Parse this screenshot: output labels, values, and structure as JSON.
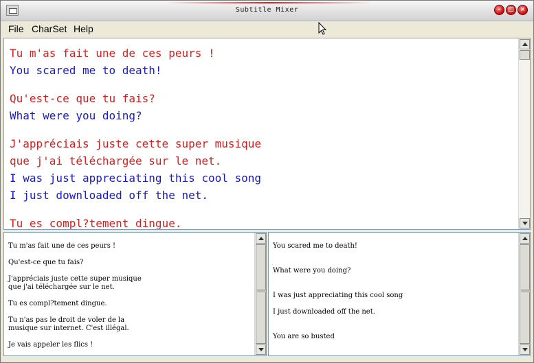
{
  "window": {
    "title": "Subtitle Mixer"
  },
  "menu": {
    "file": "File",
    "charset": "CharSet",
    "help": "Help"
  },
  "mixed": {
    "lines": [
      {
        "text": "Tu m'as fait une de ces peurs !",
        "lang": "fr"
      },
      {
        "text": "You scared me to death!",
        "lang": "en"
      },
      {
        "text": "Qu'est-ce que tu fais?",
        "lang": "fr"
      },
      {
        "text": "What were you doing?",
        "lang": "en"
      },
      {
        "text": "J'appréciais juste cette super musique",
        "lang": "fr"
      },
      {
        "text": "que j'ai téléchargée sur le net.",
        "lang": "fr"
      },
      {
        "text": "I was just appreciating this cool song",
        "lang": "en"
      },
      {
        "text": "I just downloaded off the net.",
        "lang": "en"
      },
      {
        "text": "Tu es compl?tement dingue.",
        "lang": "fr"
      }
    ]
  },
  "french": {
    "lines": [
      "Tu m'as fait une de ces peurs !",
      "Qu'est-ce que tu fais?",
      "J'appréciais juste cette super musique",
      "que j'ai téléchargée sur le net.",
      "Tu es compl?tement dingue.",
      "Tu n'as pas le droit de voler de la",
      "musique sur internet. C'est illégal.",
      "Je vais appeler les flics !"
    ]
  },
  "english": {
    "lines": [
      "You scared me to death!",
      "What were you doing?",
      "I was just appreciating this cool song",
      "I just downloaded off the net.",
      "You are so busted"
    ]
  },
  "colors": {
    "french": "#d42020",
    "english": "#1a1ac8"
  }
}
